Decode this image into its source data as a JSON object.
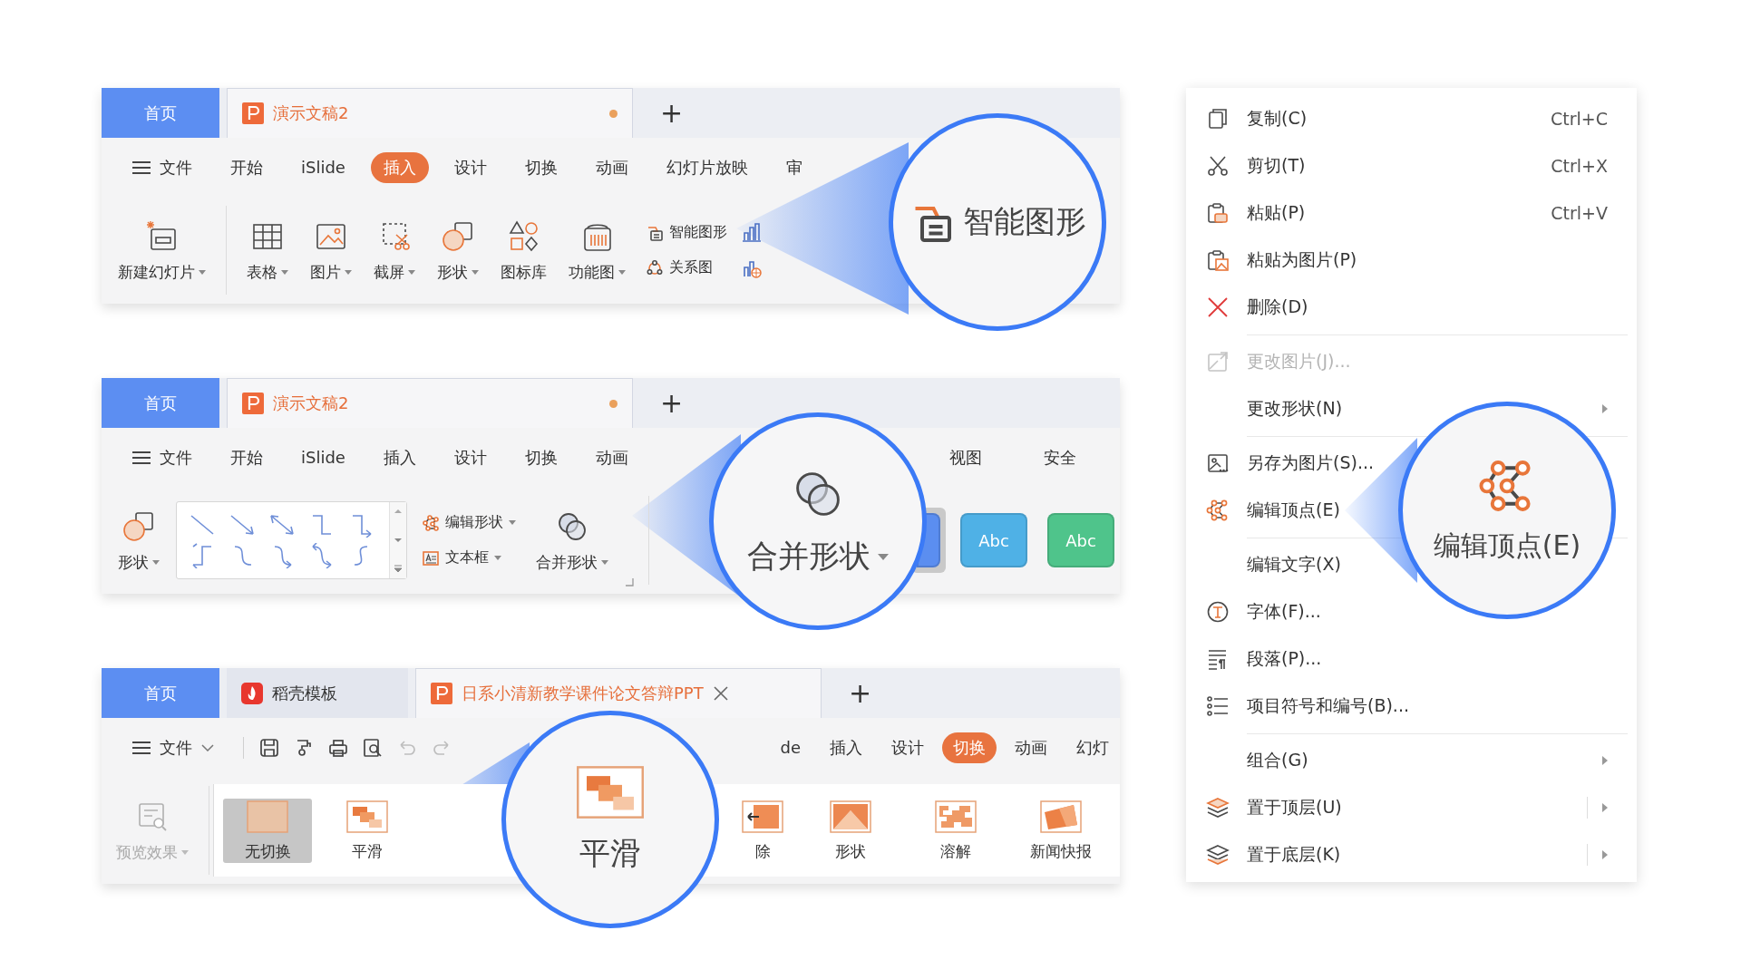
{
  "panels": [
    {
      "tabs": [
        {
          "label": "首页",
          "kind": "home",
          "selected": false
        },
        {
          "label": "演示文稿2",
          "kind": "document",
          "selected": true,
          "modified": true
        }
      ],
      "new_tab": "+",
      "menu_left": [
        {
          "label": "文件",
          "kind": "file",
          "selected": false
        },
        {
          "label": "开始",
          "kind": "tab",
          "selected": false
        },
        {
          "label": "iSlide",
          "kind": "tab",
          "selected": false
        },
        {
          "label": "插入",
          "kind": "tab",
          "selected": true
        },
        {
          "label": "设计",
          "kind": "tab",
          "selected": false
        },
        {
          "label": "切换",
          "kind": "tab",
          "selected": false
        },
        {
          "label": "动画",
          "kind": "tab",
          "selected": false
        },
        {
          "label": "幻灯片放映",
          "kind": "tab",
          "selected": false
        },
        {
          "label": "审",
          "kind": "tab",
          "selected": false
        }
      ],
      "ribbon_left": [
        {
          "kind": "large",
          "label": "新建幻灯片",
          "dropdown": true
        },
        {
          "kind": "divider"
        },
        {
          "kind": "large",
          "label": "表格",
          "dropdown": true
        },
        {
          "kind": "large",
          "label": "图片",
          "dropdown": true
        },
        {
          "kind": "large",
          "label": "截屏",
          "dropdown": true
        },
        {
          "kind": "large",
          "label": "形状",
          "dropdown": true
        },
        {
          "kind": "large",
          "label": "图标库",
          "dropdown": false
        },
        {
          "kind": "large",
          "label": "功能图",
          "dropdown": true
        },
        {
          "kind": "stack",
          "items": [
            {
              "label": "智能图形",
              "dropdown": false
            },
            {
              "label": "关系图",
              "dropdown": false
            }
          ]
        },
        {
          "kind": "icon_stack"
        }
      ],
      "magnifier": {
        "label": "智能图形"
      }
    },
    {
      "tabs": [
        {
          "label": "首页",
          "kind": "home",
          "selected": false
        },
        {
          "label": "演示文稿2",
          "kind": "document",
          "selected": true,
          "modified": true
        }
      ],
      "new_tab": "+",
      "menu_left": [
        {
          "label": "文件",
          "kind": "file",
          "selected": false
        },
        {
          "label": "开始",
          "kind": "tab",
          "selected": false
        },
        {
          "label": "iSlide",
          "kind": "tab",
          "selected": false
        },
        {
          "label": "插入",
          "kind": "tab",
          "selected": false
        },
        {
          "label": "设计",
          "kind": "tab",
          "selected": false
        },
        {
          "label": "切换",
          "kind": "tab",
          "selected": false
        },
        {
          "label": "动画",
          "kind": "tab",
          "selected": false
        }
      ],
      "menu_right": [
        {
          "label": "视图",
          "selected": false
        },
        {
          "label": "安全",
          "selected": false
        }
      ],
      "ribbon_left": [
        {
          "kind": "large",
          "label": "形状",
          "dropdown": true
        },
        {
          "kind": "line_gallery"
        },
        {
          "kind": "stack",
          "items": [
            {
              "label": "编辑形状",
              "dropdown": true
            },
            {
              "label": "文本框",
              "dropdown": true
            }
          ]
        },
        {
          "kind": "large",
          "label": "合并形状",
          "dropdown": true
        },
        {
          "kind": "launcher"
        },
        {
          "kind": "divider"
        }
      ],
      "ribbon_right": [
        {
          "kind": "swatch",
          "color": "#5b8ef0",
          "selected": true
        },
        {
          "kind": "swatch",
          "label": "Abc",
          "color": "#4fb1e6",
          "selected": false
        },
        {
          "kind": "swatch",
          "label": "Abc",
          "color": "#4fc48b",
          "selected": false
        }
      ],
      "magnifier": {
        "label": "合并形状",
        "dropdown": true
      }
    },
    {
      "tabs": [
        {
          "label": "首页",
          "kind": "home",
          "selected": false
        },
        {
          "label": "稻壳模板",
          "kind": "template",
          "selected": false
        },
        {
          "label": "日系小清新教学课件论文答辩PPT",
          "kind": "document",
          "selected": true,
          "modified": false
        }
      ],
      "new_tab": "+",
      "menu_left": [
        {
          "label": "文件",
          "kind": "file_dropdown",
          "selected": false
        },
        {
          "kind": "toolbar"
        }
      ],
      "toolbar": [
        {
          "kind": "save",
          "disabled": false
        },
        {
          "kind": "painter",
          "disabled": false
        },
        {
          "kind": "print",
          "disabled": false
        },
        {
          "kind": "preview",
          "disabled": false
        },
        {
          "kind": "undo",
          "disabled": true
        },
        {
          "kind": "redo",
          "disabled": true
        }
      ],
      "menu_right": [
        {
          "label": "de",
          "selected": false
        },
        {
          "label": "插入",
          "selected": false
        },
        {
          "label": "设计",
          "selected": false
        },
        {
          "label": "切换",
          "selected": true
        },
        {
          "label": "动画",
          "selected": false
        },
        {
          "label": "幻灯",
          "selected": false
        }
      ],
      "ribbon_left": [
        {
          "kind": "large",
          "label": "预览效果",
          "dropdown": true,
          "disabled": true
        },
        {
          "kind": "divider"
        }
      ],
      "transitions_left": [
        {
          "label": "无切换",
          "selected": true
        },
        {
          "label": "平滑",
          "selected": false
        }
      ],
      "transitions_right": [
        {
          "label": "除",
          "selected": false
        },
        {
          "label": "形状",
          "selected": false
        },
        {
          "label": "溶解",
          "selected": false
        },
        {
          "label": "新闻快报",
          "selected": false
        }
      ],
      "magnifier": {
        "label": "平滑"
      }
    }
  ],
  "context_menu": {
    "items": [
      {
        "kind": "item",
        "label": "复制(C)",
        "shortcut": "Ctrl+C",
        "disabled": false,
        "submenu": false,
        "split": false
      },
      {
        "kind": "item",
        "label": "剪切(T)",
        "shortcut": "Ctrl+X",
        "disabled": false,
        "submenu": false,
        "split": false
      },
      {
        "kind": "item",
        "label": "粘贴(P)",
        "shortcut": "Ctrl+V",
        "disabled": false,
        "submenu": false,
        "split": false
      },
      {
        "kind": "item",
        "label": "粘贴为图片(P)",
        "disabled": false,
        "submenu": false,
        "split": false
      },
      {
        "kind": "item",
        "label": "删除(D)",
        "disabled": false,
        "submenu": false,
        "split": false
      },
      {
        "kind": "separator"
      },
      {
        "kind": "item",
        "label": "更改图片(J)...",
        "disabled": true,
        "submenu": false,
        "split": false
      },
      {
        "kind": "item",
        "label": "更改形状(N)",
        "disabled": false,
        "submenu": true,
        "split": false
      },
      {
        "kind": "separator"
      },
      {
        "kind": "item",
        "label": "另存为图片(S)...",
        "disabled": false,
        "submenu": false,
        "split": false
      },
      {
        "kind": "item",
        "label": "编辑顶点(E)",
        "disabled": false,
        "submenu": false,
        "split": false
      },
      {
        "kind": "separator"
      },
      {
        "kind": "item",
        "label": "编辑文字(X)",
        "disabled": false,
        "submenu": false,
        "split": false
      },
      {
        "kind": "item",
        "label": "字体(F)...",
        "disabled": false,
        "submenu": false,
        "split": false
      },
      {
        "kind": "item",
        "label": "段落(P)...",
        "disabled": false,
        "submenu": false,
        "split": false
      },
      {
        "kind": "item",
        "label": "项目符号和编号(B)...",
        "disabled": false,
        "submenu": false,
        "split": false
      },
      {
        "kind": "separator"
      },
      {
        "kind": "item",
        "label": "组合(G)",
        "disabled": false,
        "submenu": true,
        "split": false
      },
      {
        "kind": "item",
        "label": "置于顶层(U)",
        "disabled": false,
        "submenu": true,
        "split": true
      },
      {
        "kind": "item",
        "label": "置于底层(K)",
        "disabled": false,
        "submenu": true,
        "split": true
      }
    ],
    "magnifier": {
      "label": "编辑顶点(E)"
    }
  }
}
